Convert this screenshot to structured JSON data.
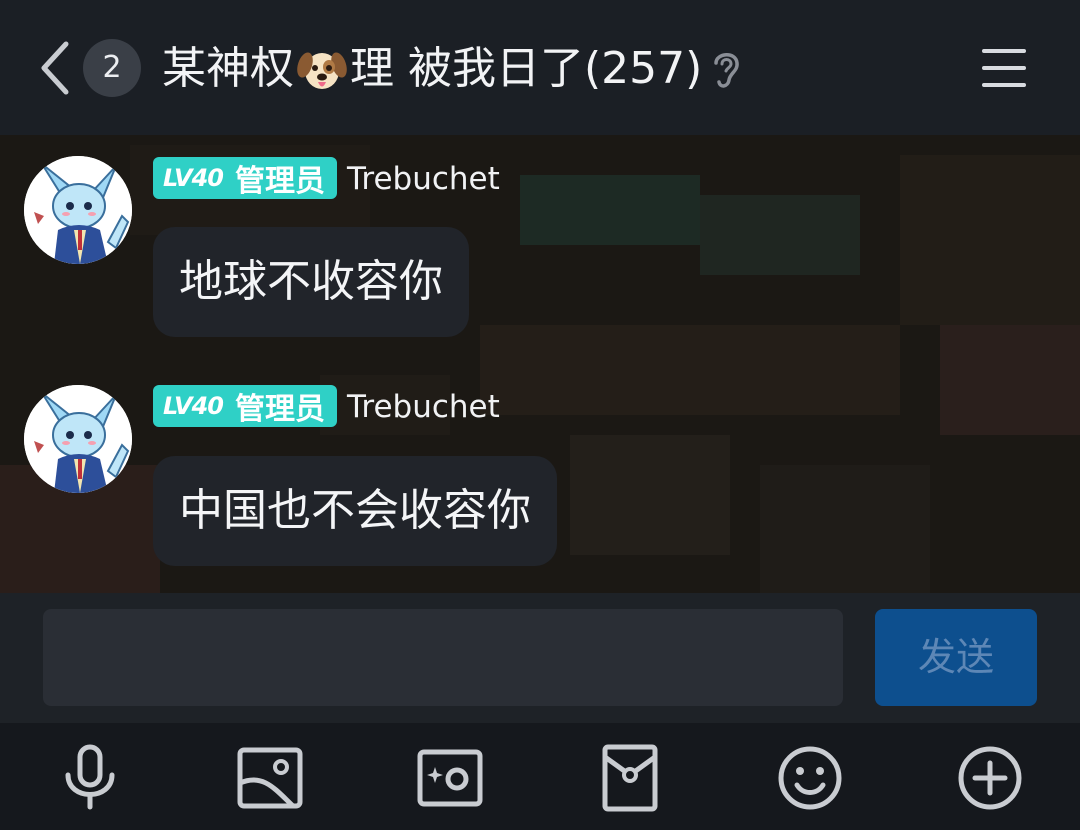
{
  "header": {
    "unread_count": "2",
    "title_before_emoji": "某神权",
    "title_emoji": "dog-face-emoji",
    "title_after_emoji": "理 被我日了(257)",
    "icons": {
      "back": "chevron-left-icon",
      "listen": "ear-icon",
      "menu": "hamburger-menu-icon"
    }
  },
  "messages": [
    {
      "level": "LV40",
      "role": "管理员",
      "sender": "Trebuchet",
      "text": "地球不收容你",
      "avatar": "blue-pokemon-avatar"
    },
    {
      "level": "LV40",
      "role": "管理员",
      "sender": "Trebuchet",
      "text": "中国也不会收容你",
      "avatar": "blue-pokemon-avatar"
    }
  ],
  "composer": {
    "input_value": "",
    "input_placeholder": "",
    "send_label": "发送"
  },
  "toolbar": {
    "icons": [
      "microphone-icon",
      "image-icon",
      "camera-icon",
      "red-packet-icon",
      "emoji-smile-icon",
      "plus-circle-icon"
    ]
  },
  "colors": {
    "header_bg": "#1b1f25",
    "bubble_bg": "#21242a",
    "level_badge": "#2fd0c6",
    "send_button_bg": "#0d4f8e",
    "send_button_text": "#5d87b6"
  }
}
